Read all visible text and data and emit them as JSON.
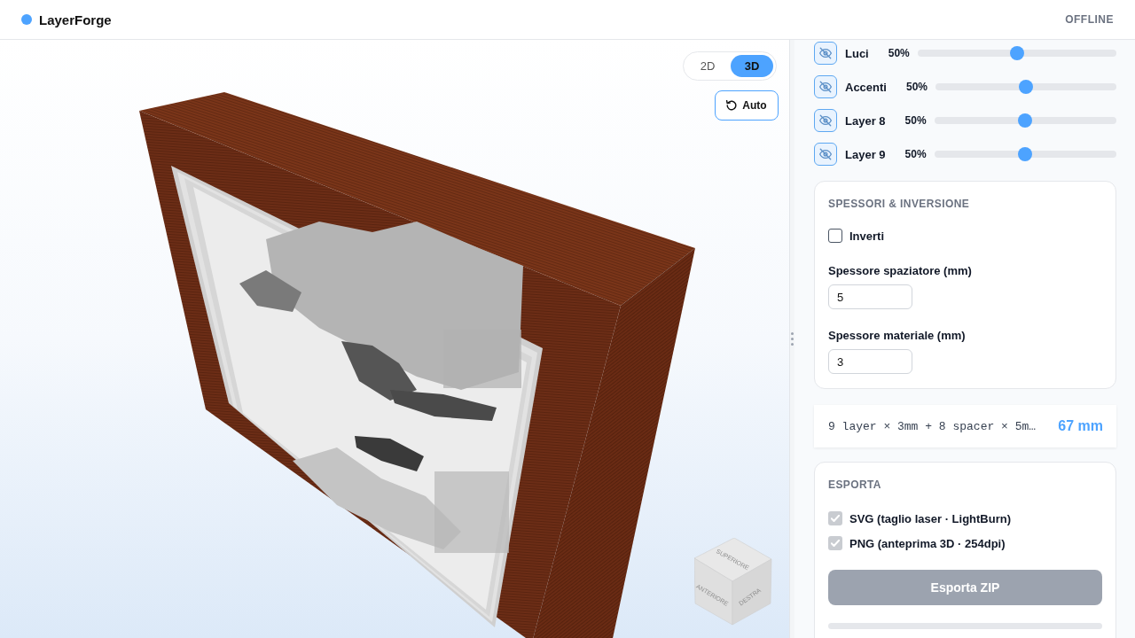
{
  "header": {
    "title": "LayerForge",
    "status": "OFFLINE"
  },
  "view_mode": [
    {
      "label": "2D",
      "selected": false
    },
    {
      "label": "3D",
      "selected": true
    }
  ],
  "auto_button": {
    "label": "Auto"
  },
  "view_cube": {
    "faces": [
      {
        "kind": "top",
        "label": "SUPERIORE"
      },
      {
        "kind": "front",
        "label": "ANTERIORE"
      },
      {
        "kind": "right",
        "label": "DESTRA"
      }
    ]
  },
  "layers": [
    {
      "name": "Luci",
      "reading": "50%",
      "level": 0.5
    },
    {
      "name": "Accenti",
      "reading": "50%",
      "level": 0.5
    },
    {
      "name": "Layer 8",
      "reading": "50%",
      "level": 0.5
    },
    {
      "name": "Layer 9",
      "reading": "50%",
      "level": 0.5
    }
  ],
  "thickness": {
    "title": "SPESSORI & INVERSIONE",
    "invert": {
      "label": "Inverti",
      "checked": false
    },
    "fields": [
      {
        "label": "Spessore spaziatore (mm)",
        "value": "5"
      },
      {
        "label": "Spessore materiale (mm)",
        "value": "3"
      }
    ]
  },
  "summary": {
    "formula": "9 layer × 3mm + 8 spacer × 5m…",
    "total": "67 mm"
  },
  "export": {
    "title": "ESPORTA",
    "options": [
      {
        "label": "SVG (taglio laser · LightBurn)",
        "checked": true,
        "disabled": true
      },
      {
        "label": "PNG (anteprima 3D · 254dpi)",
        "checked": true,
        "disabled": true
      }
    ],
    "button": {
      "label": "Esporta ZIP",
      "disabled": true
    },
    "progress": {
      "level": 0
    }
  }
}
